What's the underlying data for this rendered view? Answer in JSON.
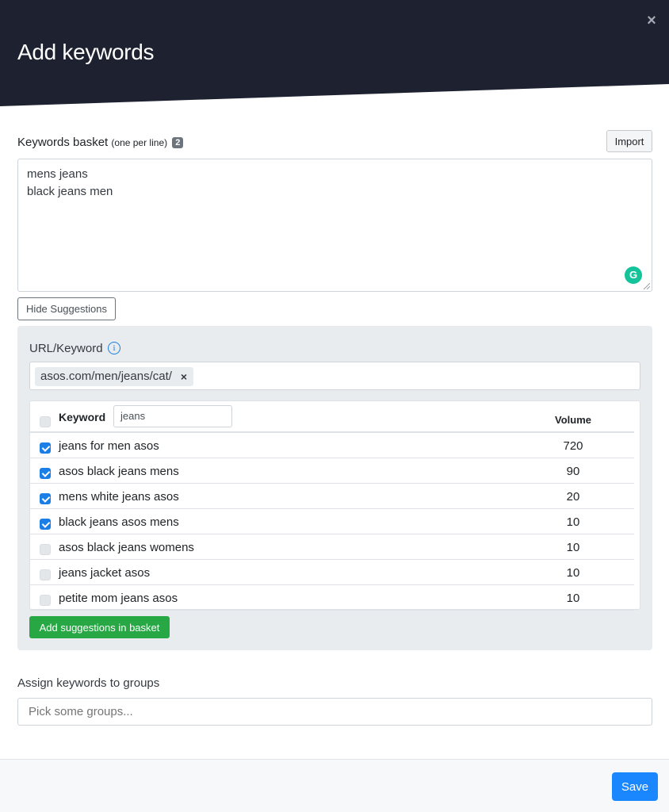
{
  "modal": {
    "title": "Add keywords",
    "close_symbol": "×"
  },
  "basket": {
    "label": "Keywords basket",
    "hint": "(one per line)",
    "count": "2",
    "import_label": "Import",
    "lines": [
      "mens jeans",
      "black jeans men"
    ],
    "grammarly_letter": "G"
  },
  "hide_suggestions_label": "Hide Suggestions",
  "suggestions": {
    "url_label": "URL/Keyword",
    "info_symbol": "i",
    "tag_value": "asos.com/men/jeans/cat/",
    "tag_remove_symbol": "×",
    "table": {
      "keyword_header": "Keyword",
      "filter_value": "jeans",
      "volume_header": "Volume",
      "select_all_checked": false,
      "rows": [
        {
          "keyword": "jeans for men asos",
          "volume": "720",
          "checked": true
        },
        {
          "keyword": "asos black jeans mens",
          "volume": "90",
          "checked": true
        },
        {
          "keyword": "mens white jeans asos",
          "volume": "20",
          "checked": true
        },
        {
          "keyword": "black jeans asos mens",
          "volume": "10",
          "checked": true
        },
        {
          "keyword": "asos black jeans womens",
          "volume": "10",
          "checked": false
        },
        {
          "keyword": "jeans jacket asos",
          "volume": "10",
          "checked": false
        },
        {
          "keyword": "petite mom jeans asos",
          "volume": "10",
          "checked": false
        }
      ]
    },
    "add_button_label": "Add suggestions in basket"
  },
  "groups": {
    "label": "Assign keywords to groups",
    "placeholder": "Pick some groups..."
  },
  "footer": {
    "save_label": "Save"
  },
  "colors": {
    "header_bg": "#1e2230",
    "primary": "#1a87ff",
    "success": "#28a745",
    "checkbox_on": "#1a7ee6"
  }
}
